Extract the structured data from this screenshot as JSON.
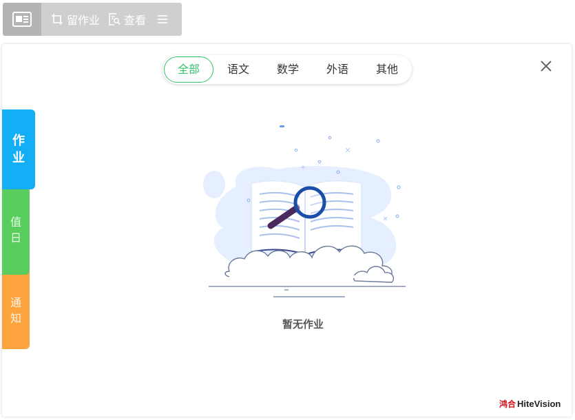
{
  "toolbar": {
    "assign_label": "留作业",
    "view_label": "查看"
  },
  "tabs": [
    {
      "label": "全部",
      "active": true
    },
    {
      "label": "语文",
      "active": false
    },
    {
      "label": "数学",
      "active": false
    },
    {
      "label": "外语",
      "active": false
    },
    {
      "label": "其他",
      "active": false
    }
  ],
  "side_tabs": {
    "homework": [
      "作",
      "业"
    ],
    "duty": [
      "值",
      "日"
    ],
    "notice": [
      "通",
      "知"
    ]
  },
  "empty_state": {
    "message": "暂无作业"
  },
  "brand": {
    "cn": "鸿合",
    "en": "HiteVision"
  },
  "colors": {
    "accent_green": "#36c06a",
    "homework_blue": "#13aef5",
    "duty_green": "#5acd5f",
    "notice_orange": "#fca33e",
    "brand_red": "#d0161d"
  }
}
